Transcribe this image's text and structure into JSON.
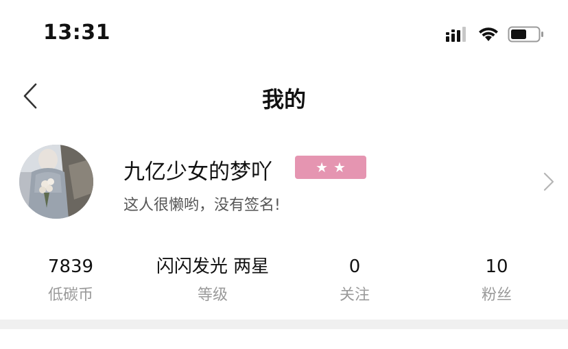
{
  "status_bar": {
    "time": "13:31",
    "icons": [
      "signal-icon",
      "wifi-icon",
      "battery-icon"
    ]
  },
  "nav": {
    "back_icon": "chevron-left-icon",
    "title": "我的"
  },
  "profile": {
    "avatar_icon": "avatar-photo",
    "username": "九亿少女的梦吖",
    "level_stars": 2,
    "badge_color": "#e595b1",
    "signature": "这人很懒哟，没有签名!",
    "chevron_icon": "chevron-right-icon"
  },
  "stats": [
    {
      "value": "7839",
      "label": "低碳币"
    },
    {
      "value": "闪闪发光 两星",
      "label": "等级"
    },
    {
      "value": "0",
      "label": "关注"
    },
    {
      "value": "10",
      "label": "粉丝"
    }
  ],
  "colors": {
    "background": "#ffffff",
    "divider": "#f0f0f0",
    "label_gray": "#9a9a9a"
  }
}
